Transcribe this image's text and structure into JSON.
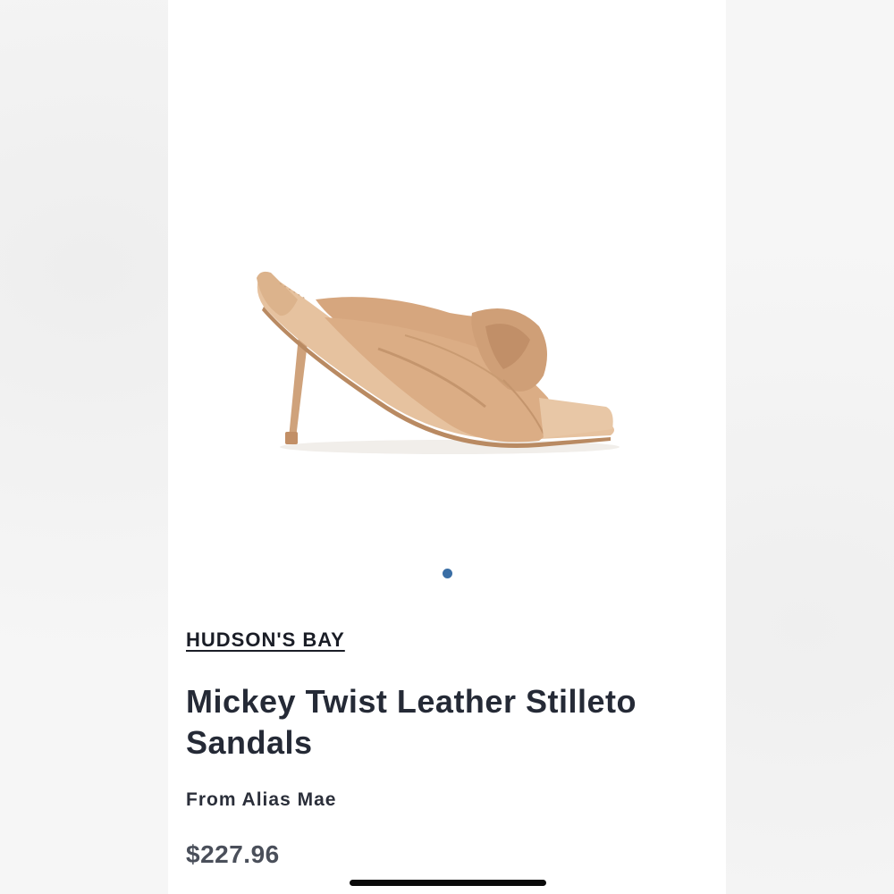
{
  "product": {
    "image_alt": "Mickey Twist Leather Stilleto Sandals",
    "image_color": "#d9ae87",
    "carousel": {
      "active_index": 0,
      "count": 1,
      "dot_color": "#3a6ea5"
    },
    "brand": "HUDSON'S BAY",
    "title": "Mickey Twist Leather Stilleto Sandals",
    "seller": "From Alias Mae",
    "price": "$227.96"
  }
}
